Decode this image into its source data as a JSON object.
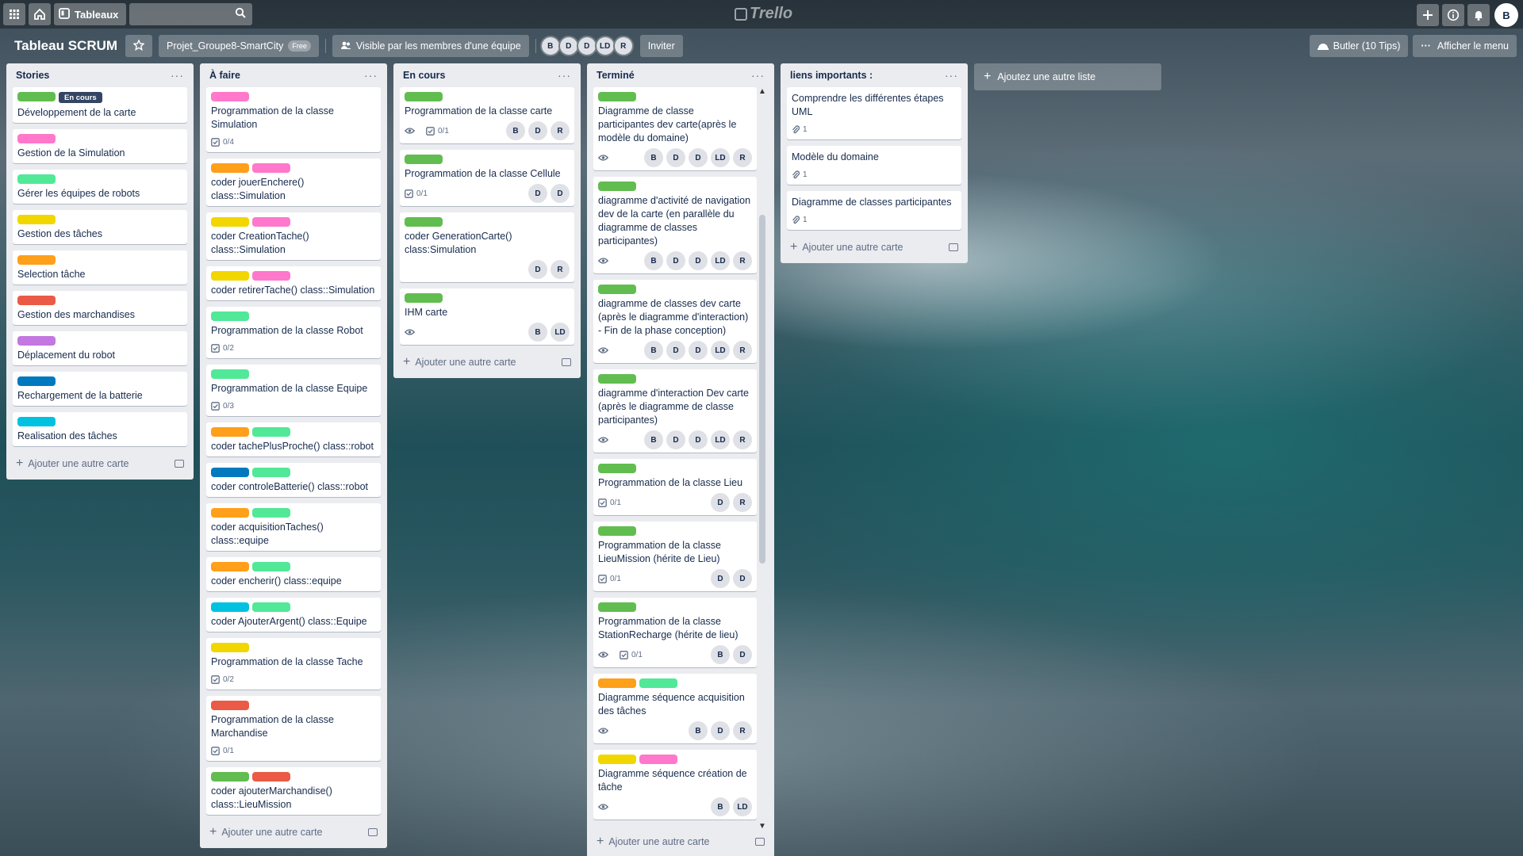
{
  "colors": {
    "green": "#61bd4f",
    "pink": "#ff78cb",
    "mint": "#51e898",
    "yellow": "#f2d600",
    "orange": "#ff9f1a",
    "red": "#eb5a46",
    "purple": "#c377e0",
    "blue": "#0079bf",
    "sky": "#00c2e0"
  },
  "topbar": {
    "boards_label": "Tableaux",
    "logo": "Trello",
    "user_initial": "B"
  },
  "boardbar": {
    "title": "Tableau SCRUM",
    "team": "Projet_Groupe8-SmartCity",
    "team_badge": "Free",
    "visibility": "Visible par les membres d'une équipe",
    "members": [
      "B",
      "D",
      "D",
      "LD",
      "R"
    ],
    "invite": "Inviter",
    "butler": "Butler (10 Tips)",
    "menu": "Afficher le menu"
  },
  "add_card_label": "Ajouter une autre carte",
  "add_list_label": "Ajoutez une autre liste",
  "lists": [
    {
      "title": "Stories",
      "cards": [
        {
          "labels": [
            "green"
          ],
          "label_text": "En cours",
          "title": "Développement de la carte"
        },
        {
          "labels": [
            "pink"
          ],
          "title": "Gestion de la Simulation"
        },
        {
          "labels": [
            "mint"
          ],
          "title": "Gérer les équipes de robots"
        },
        {
          "labels": [
            "yellow"
          ],
          "title": "Gestion des tâches"
        },
        {
          "labels": [
            "orange"
          ],
          "title": "Selection tâche"
        },
        {
          "labels": [
            "red"
          ],
          "title": "Gestion des marchandises"
        },
        {
          "labels": [
            "purple"
          ],
          "title": "Déplacement du robot"
        },
        {
          "labels": [
            "blue"
          ],
          "title": "Rechargement de la batterie"
        },
        {
          "labels": [
            "sky"
          ],
          "title": "Realisation des tâches"
        }
      ]
    },
    {
      "title": "À faire",
      "cards": [
        {
          "labels": [
            "pink"
          ],
          "title": "Programmation de la classe Simulation",
          "checklist": "0/4"
        },
        {
          "labels": [
            "orange",
            "pink"
          ],
          "title": "coder jouerEnchere() class::Simulation"
        },
        {
          "labels": [
            "yellow",
            "pink"
          ],
          "title": "coder CreationTache() class::Simulation"
        },
        {
          "labels": [
            "yellow",
            "pink"
          ],
          "title": "coder retirerTache() class::Simulation"
        },
        {
          "labels": [
            "mint"
          ],
          "title": "Programmation de la classe Robot",
          "checklist": "0/2"
        },
        {
          "labels": [
            "mint"
          ],
          "title": "Programmation de la classe Equipe",
          "checklist": "0/3"
        },
        {
          "labels": [
            "orange",
            "mint"
          ],
          "title": "coder tachePlusProche() class::robot"
        },
        {
          "labels": [
            "blue",
            "mint"
          ],
          "title": "coder controleBatterie() class::robot"
        },
        {
          "labels": [
            "orange",
            "mint"
          ],
          "title": "coder acquisitionTaches() class::equipe"
        },
        {
          "labels": [
            "orange",
            "mint"
          ],
          "title": "coder encherir() class::equipe"
        },
        {
          "labels": [
            "sky",
            "mint"
          ],
          "title": "coder AjouterArgent() class::Equipe"
        },
        {
          "labels": [
            "yellow"
          ],
          "title": "Programmation de la classe Tache",
          "checklist": "0/2"
        },
        {
          "labels": [
            "red"
          ],
          "title": "Programmation de la classe Marchandise",
          "checklist": "0/1"
        },
        {
          "labels": [
            "green",
            "red"
          ],
          "title": "coder ajouterMarchandise() class::LieuMission"
        }
      ]
    },
    {
      "title": "En cours",
      "cards": [
        {
          "labels": [
            "green"
          ],
          "title": "Programmation de la classe carte",
          "watch": true,
          "checklist": "0/1",
          "members": [
            "B",
            "D",
            "R"
          ]
        },
        {
          "labels": [
            "green"
          ],
          "title": "Programmation de la classe Cellule",
          "checklist": "0/1",
          "members": [
            "D",
            "D"
          ]
        },
        {
          "labels": [
            "green"
          ],
          "title": "coder GenerationCarte() class:Simulation",
          "members": [
            "D",
            "R"
          ]
        },
        {
          "labels": [
            "green"
          ],
          "title": "IHM carte",
          "watch": true,
          "members": [
            "B",
            "LD"
          ]
        }
      ]
    },
    {
      "title": "Terminé",
      "cards": [
        {
          "labels": [
            "green"
          ],
          "title": "Diagramme de classe participantes dev carte(après le modèle du domaine)",
          "watch": true,
          "members": [
            "B",
            "D",
            "D",
            "LD",
            "R"
          ]
        },
        {
          "labels": [
            "green"
          ],
          "title": "diagramme d'activité de navigation dev de la carte (en parallèle du diagramme de classes participantes)",
          "watch": true,
          "members": [
            "B",
            "D",
            "D",
            "LD",
            "R"
          ]
        },
        {
          "labels": [
            "green"
          ],
          "title": "diagramme de classes dev carte (après le diagramme d'interaction) - Fin de la phase conception)",
          "watch": true,
          "members": [
            "B",
            "D",
            "D",
            "LD",
            "R"
          ]
        },
        {
          "labels": [
            "green"
          ],
          "title": "diagramme d'interaction Dev carte (après le diagramme de classe participantes)",
          "watch": true,
          "members": [
            "B",
            "D",
            "D",
            "LD",
            "R"
          ]
        },
        {
          "labels": [
            "green"
          ],
          "title": "Programmation de la classe Lieu",
          "checklist": "0/1",
          "members": [
            "D",
            "R"
          ]
        },
        {
          "labels": [
            "green"
          ],
          "title": "Programmation de la classe LieuMission (hérite de Lieu)",
          "checklist": "0/1",
          "members": [
            "D",
            "D"
          ]
        },
        {
          "labels": [
            "green"
          ],
          "title": "Programmation de la classe StationRecharge (hérite de lieu)",
          "watch": true,
          "checklist": "0/1",
          "members": [
            "B",
            "D"
          ]
        },
        {
          "labels": [
            "orange",
            "mint"
          ],
          "title": "Diagramme séquence acquisition des tâches",
          "watch": true,
          "members": [
            "B",
            "D",
            "R"
          ]
        },
        {
          "labels": [
            "yellow",
            "pink"
          ],
          "title": "Diagramme séquence création de tâche",
          "watch": true,
          "members": [
            "B",
            "LD"
          ]
        }
      ]
    },
    {
      "title": "liens importants :",
      "cards": [
        {
          "title": "Comprendre les différentes étapes UML",
          "attachments": "1"
        },
        {
          "title": "Modèle du domaine",
          "attachments": "1"
        },
        {
          "title": "Diagramme de classes participantes",
          "attachments": "1"
        }
      ]
    }
  ]
}
